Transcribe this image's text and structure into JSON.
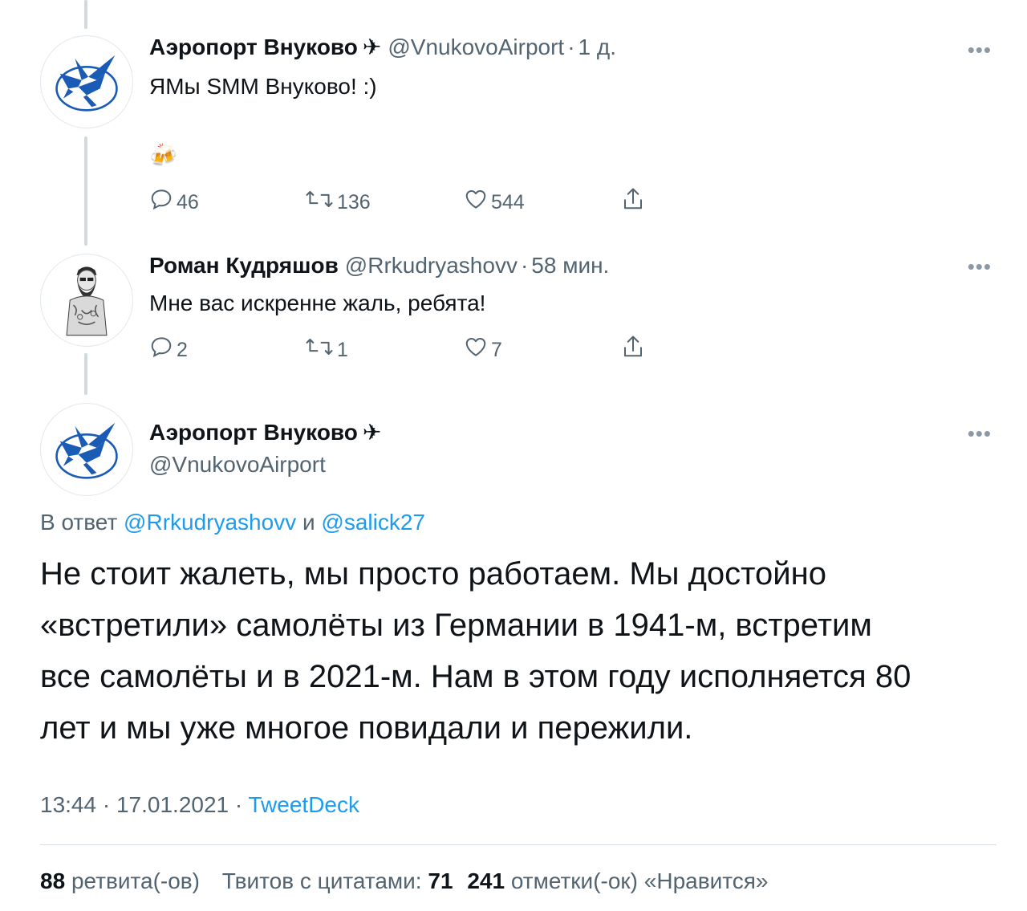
{
  "tweet1": {
    "name": "Аэропорт Внуково",
    "plane": "✈",
    "handle": "@VnukovoAirport",
    "sep": "·",
    "time": "1 д.",
    "text": "ЯМы SMM Внуково! :)",
    "emoji": "🍻",
    "replies": "46",
    "retweets": "136",
    "likes": "544"
  },
  "tweet2": {
    "name": "Роман Кудряшов",
    "handle": "@Rrkudryashovv",
    "sep": "·",
    "time": "58 мин.",
    "text": "Мне вас искренне жаль, ребята!",
    "replies": "2",
    "retweets": "1",
    "likes": "7"
  },
  "main": {
    "name": "Аэропорт Внуково",
    "plane": "✈",
    "handle": "@VnukovoAirport",
    "reply_prefix": "В ответ ",
    "reply_user1": "@Rrkudryashovv",
    "reply_and": " и ",
    "reply_user2": "@salick27",
    "text_lines": [
      "Не стоит жалеть, мы просто работаем. Мы достойно",
      "«встретили» самолёты из Германии в 1941-м, встретим",
      "все самолёты и в 2021-м. Нам в этом году исполняется 80",
      "лет и мы уже многое повидали и пережили."
    ],
    "time": "13:44",
    "sep": " · ",
    "date": "17.01.2021",
    "source": "TweetDeck"
  },
  "stats": {
    "retweets_count": "88",
    "retweets_label": "ретвита(-ов)",
    "quotes_label": "Твитов с цитатами:",
    "quotes_count": "71",
    "likes_count": "241",
    "likes_label": "отметки(-ок) «Нравится»"
  },
  "more_glyph": "•••",
  "colors": {
    "accent": "#1d9bf0",
    "muted": "#536471",
    "text": "#0f1419",
    "logo_blue": "#1a5bb5"
  },
  "icons": {
    "reply": "reply-icon",
    "retweet": "retweet-icon",
    "like": "heart-icon",
    "share": "share-icon",
    "more": "more-icon",
    "logo": "vnukovo-pegasus-logo"
  }
}
